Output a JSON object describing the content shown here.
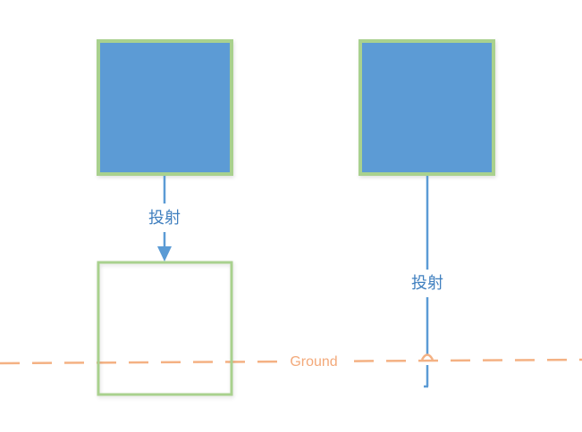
{
  "diagram": {
    "left_projection_label": "投射",
    "right_projection_label": "投射",
    "ground_label": "Ground"
  },
  "colors": {
    "box_fill": "#5b9bd5",
    "box_border": "#a9d18e",
    "projection_line": "#5b9bd5",
    "projection_text": "#3f7fbf",
    "ground_line": "#f4b183"
  }
}
